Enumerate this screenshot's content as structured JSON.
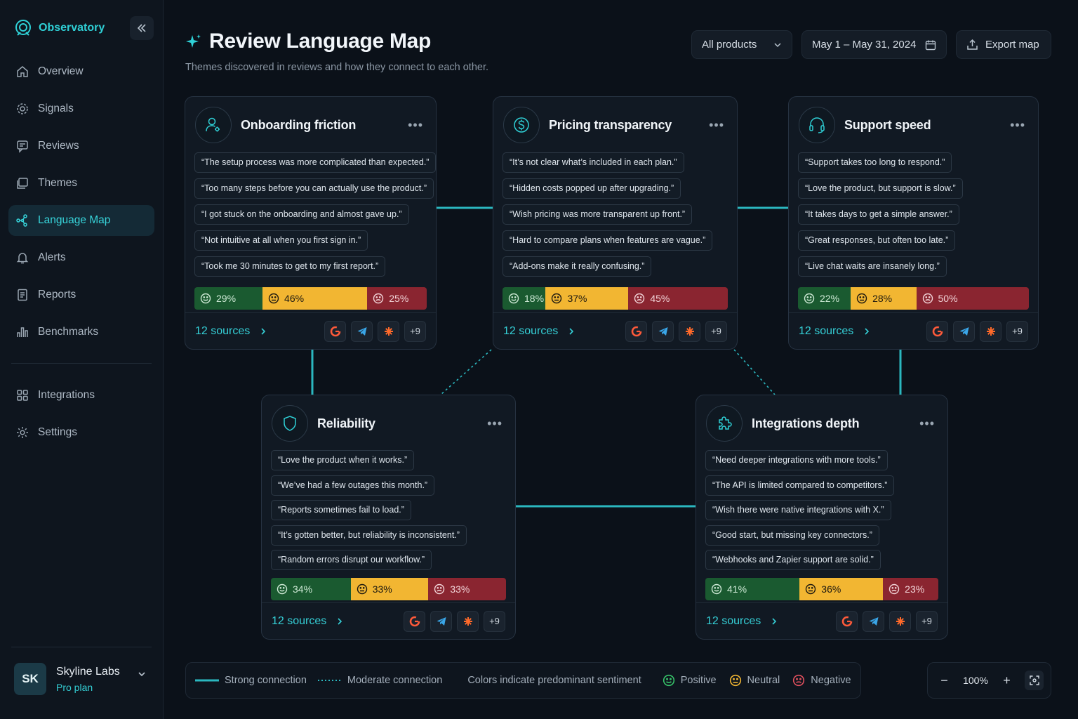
{
  "app": {
    "name": "Observatory"
  },
  "nav": {
    "items": [
      {
        "label": "Overview"
      },
      {
        "label": "Signals"
      },
      {
        "label": "Reviews"
      },
      {
        "label": "Themes"
      },
      {
        "label": "Language Map"
      },
      {
        "label": "Alerts"
      },
      {
        "label": "Reports"
      },
      {
        "label": "Benchmarks"
      }
    ],
    "secondary": [
      {
        "label": "Integrations"
      },
      {
        "label": "Settings"
      }
    ]
  },
  "account": {
    "initials": "SK",
    "name": "Skyline Labs",
    "plan": "Pro plan"
  },
  "header": {
    "title": "Review Language Map",
    "subtitle": "Themes discovered in reviews and how they connect to each other.",
    "product_filter": "All products",
    "date_range": "May 1 – May 31, 2024",
    "export_label": "Export map"
  },
  "cards": [
    {
      "title": "Onboarding friction",
      "quotes": [
        "“The setup process was more complicated than expected.”",
        "“Too many steps before you can actually use the product.”",
        "“I got stuck on the onboarding and almost gave up.”",
        "“Not intuitive at all when you first sign in.”",
        "“Took me 30 minutes to get to my first report.”"
      ],
      "sentiment": {
        "positive": 29,
        "neutral": 46,
        "negative": 25
      },
      "sentiment_labels": {
        "positive": "29%",
        "neutral": "46%",
        "negative": "25%"
      },
      "sources_label": "12 sources",
      "more_sources": "+9"
    },
    {
      "title": "Pricing transparency",
      "quotes": [
        "“It’s not clear what’s included in each plan.”",
        "“Hidden costs popped up after upgrading.”",
        "“Wish pricing was more transparent up front.”",
        "“Hard to compare plans when features are vague.”",
        "“Add-ons make it really confusing.”"
      ],
      "sentiment": {
        "positive": 18,
        "neutral": 37,
        "negative": 45
      },
      "sentiment_labels": {
        "positive": "18%",
        "neutral": "37%",
        "negative": "45%"
      },
      "sources_label": "12 sources",
      "more_sources": "+9"
    },
    {
      "title": "Support speed",
      "quotes": [
        "“Support takes too long to respond.”",
        "“Love the product, but support is slow.”",
        "“It takes days to get a simple answer.”",
        "“Great responses, but often too late.”",
        "“Live chat waits are insanely long.”"
      ],
      "sentiment": {
        "positive": 22,
        "neutral": 28,
        "negative": 50
      },
      "sentiment_labels": {
        "positive": "22%",
        "neutral": "28%",
        "negative": "50%"
      },
      "sources_label": "12 sources",
      "more_sources": "+9"
    },
    {
      "title": "Reliability",
      "quotes": [
        "“Love the product when it works.”",
        "“We’ve had a few outages this month.”",
        "“Reports sometimes fail to load.”",
        "“It’s gotten better, but reliability is inconsistent.”",
        "“Random errors disrupt our workflow.”"
      ],
      "sentiment": {
        "positive": 34,
        "neutral": 33,
        "negative": 33
      },
      "sentiment_labels": {
        "positive": "34%",
        "neutral": "33%",
        "negative": "33%"
      },
      "sources_label": "12 sources",
      "more_sources": "+9"
    },
    {
      "title": "Integrations depth",
      "quotes": [
        "“Need deeper integrations with more tools.”",
        "“The API is limited compared to competitors.”",
        "“Wish there were native integrations with X.”",
        "“Good start, but missing key connectors.”",
        "“Webhooks and Zapier support are solid.”"
      ],
      "sentiment": {
        "positive": 41,
        "neutral": 36,
        "negative": 23
      },
      "sentiment_labels": {
        "positive": "41%",
        "neutral": "36%",
        "negative": "23%"
      },
      "sources_label": "12 sources",
      "more_sources": "+9"
    }
  ],
  "legend": {
    "strong": "Strong connection",
    "moderate": "Moderate connection",
    "note": "Colors indicate predominant sentiment",
    "positive": "Positive",
    "neutral": "Neutral",
    "negative": "Negative"
  },
  "zoom": {
    "level": "100%",
    "minus": "−",
    "plus": "+"
  },
  "colors": {
    "accent": "#2fd0d6",
    "positive": "#1a5a30",
    "neutral": "#f2b632",
    "negative": "#8a2530",
    "connector": "#2bb7bf"
  },
  "icons": {
    "source_icons": [
      "g2-icon",
      "telegram-icon",
      "asterisk-icon"
    ]
  }
}
